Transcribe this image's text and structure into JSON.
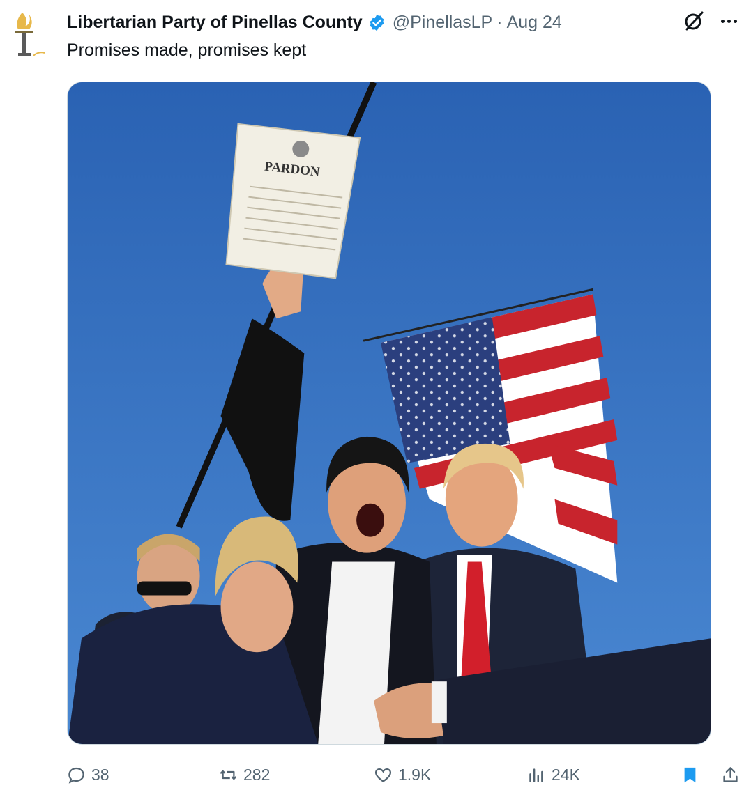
{
  "author": {
    "name": "Libertarian Party of Pinellas County",
    "handle": "@PinellasLP",
    "separator": "·",
    "date": "Aug 24"
  },
  "tweet": {
    "text": "Promises made, promises kept"
  },
  "media": {
    "document_title": "PARDON"
  },
  "stats": {
    "replies": "38",
    "reposts": "282",
    "likes": "1.9K",
    "views": "24K"
  },
  "icons": {
    "avatar": "torch-logo",
    "verified": "verified-badge-icon",
    "grok": "grok-icon",
    "more": "more-icon",
    "reply": "reply-icon",
    "repost": "repost-icon",
    "like": "heart-icon",
    "views": "views-chart-icon",
    "bookmark": "bookmark-icon",
    "share": "share-icon"
  },
  "colors": {
    "accent": "#1d9bf0",
    "text": "#0f1419",
    "muted": "#536471",
    "torch": "#e7b84a"
  }
}
